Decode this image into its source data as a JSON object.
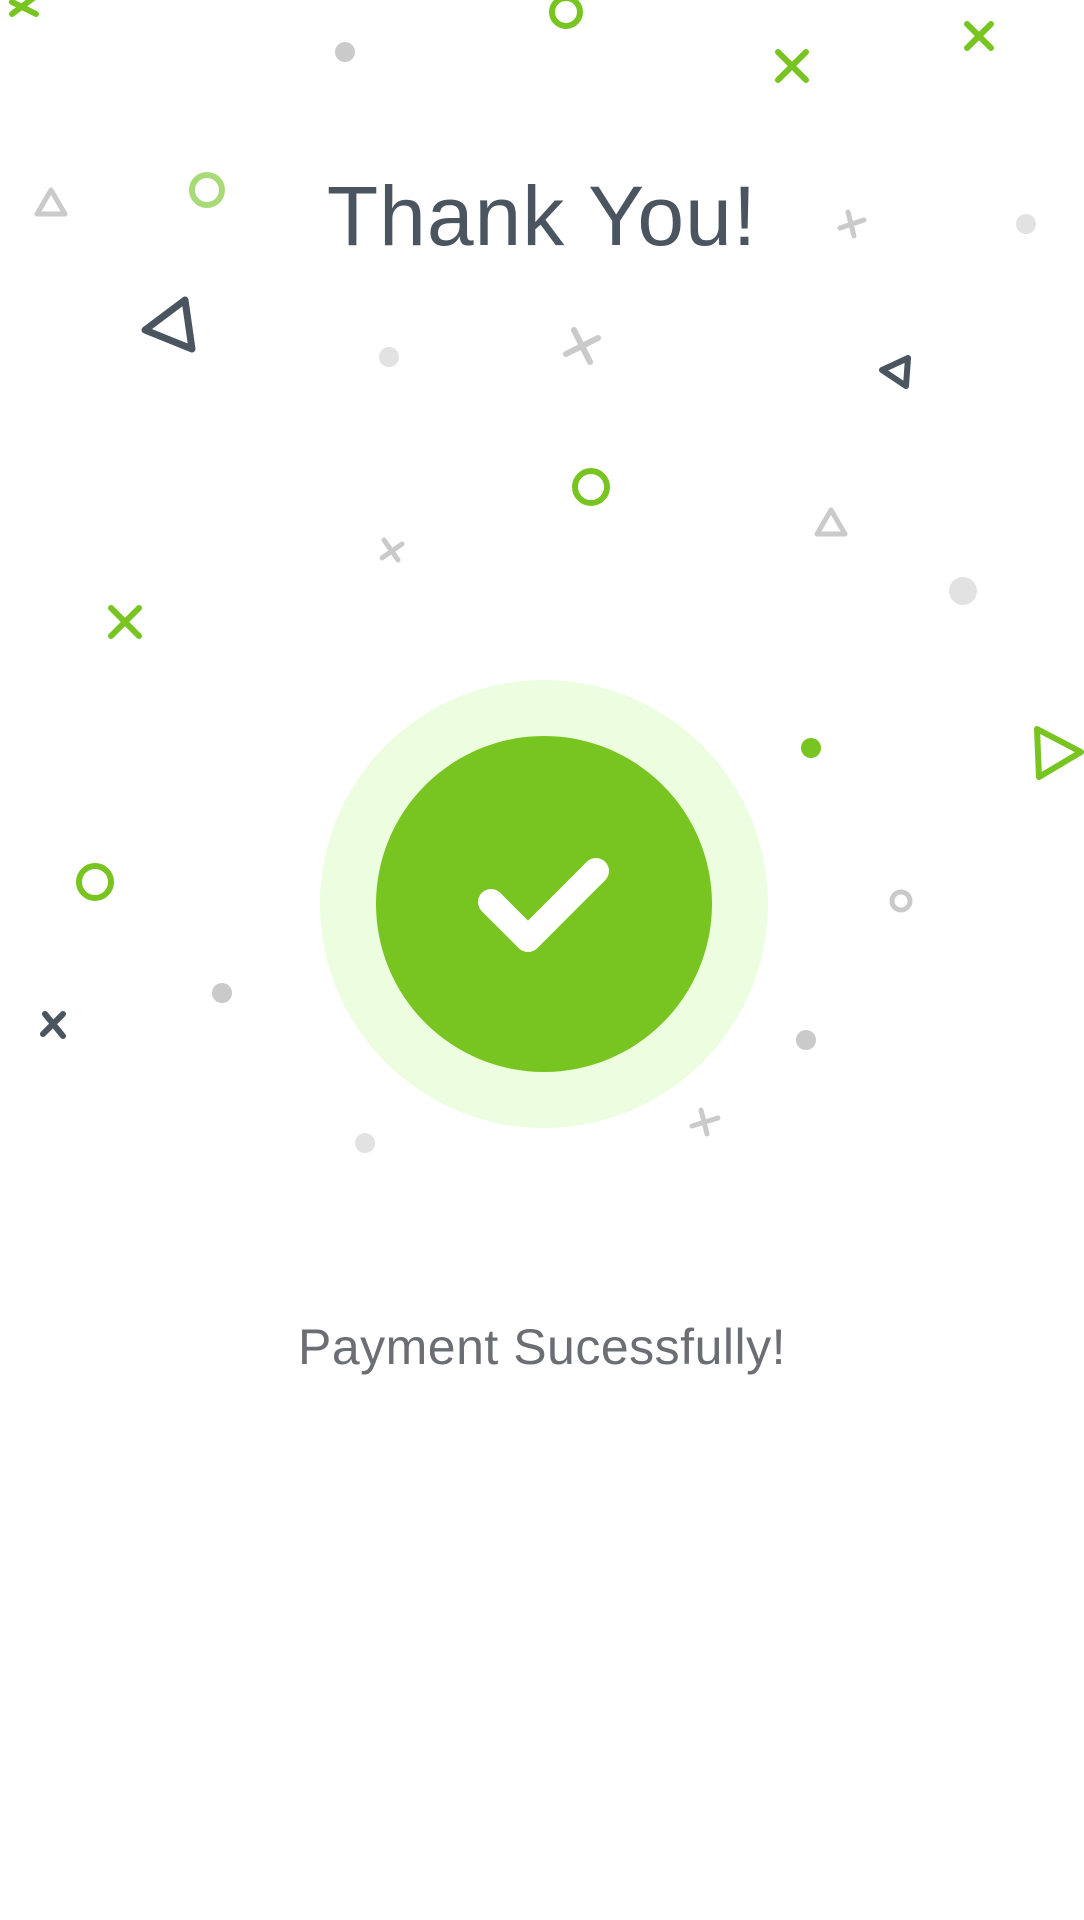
{
  "screen": {
    "title": "Thank You!",
    "message": "Payment Sucessfully!",
    "status_icon": "checkmark-icon"
  },
  "colors": {
    "accent": "#78C521",
    "accent_light": "#A8DB78",
    "accent_halo": "#EDFDE0",
    "title_text": "#4A5560",
    "message_text": "#6B6E72",
    "confetti_grey": "#CACACA",
    "confetti_light_grey": "#E2E2E2",
    "confetti_dark": "#4A5560"
  }
}
